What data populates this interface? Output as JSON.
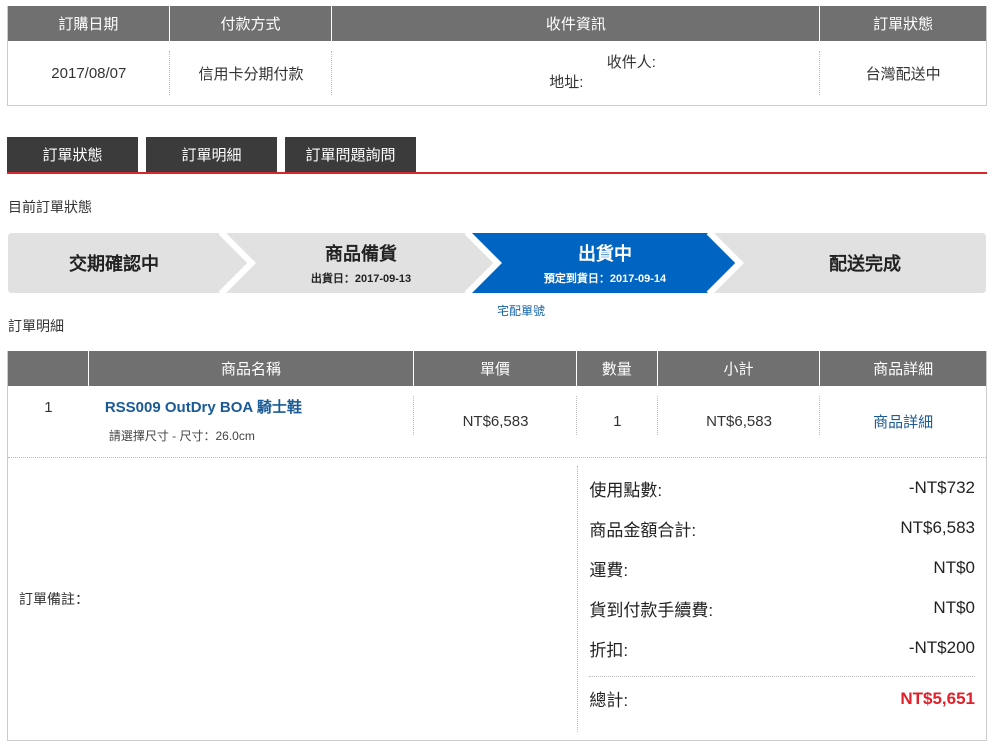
{
  "summary": {
    "headers": [
      "訂購日期",
      "付款方式",
      "收件資訊",
      "訂單狀態"
    ],
    "date": "2017/08/07",
    "payment": "信用卡分期付款",
    "recipient_label": "收件人:",
    "address_label": "地址:",
    "status": "台灣配送中"
  },
  "tabs": [
    "訂單狀態",
    "訂單明細",
    "訂單問題詢問"
  ],
  "status_section_label": "目前訂單狀態",
  "steps": [
    {
      "title": "交期確認中",
      "sub": ""
    },
    {
      "title": "商品備貨",
      "sub": "出貨日：2017-09-13"
    },
    {
      "title": "出貨中",
      "sub": "預定到貨日：2017-09-14"
    },
    {
      "title": "配送完成",
      "sub": ""
    }
  ],
  "active_step": 2,
  "colors": {
    "step_active": "#0064c2",
    "step_inactive": "#e1e1e1",
    "accent_red": "#d9262c"
  },
  "tracking_link": "宅配單號",
  "detail_section_label": "訂單明細",
  "items": {
    "headers": [
      "",
      "商品名稱",
      "單價",
      "數量",
      "小計",
      "商品詳細"
    ],
    "rows": [
      {
        "index": "1",
        "name": "RSS009 OutDry BOA 騎士鞋",
        "spec": "請選擇尺寸 - 尺寸：26.0cm",
        "price": "NT$6,583",
        "qty": "1",
        "subtotal": "NT$6,583",
        "detail": "商品詳細"
      }
    ]
  },
  "note_label": "訂單備註：",
  "totals": {
    "points_label": "使用點數:",
    "points": "-NT$732",
    "goods_label": "商品金額合計:",
    "goods": "NT$6,583",
    "shipping_label": "運費:",
    "shipping": "NT$0",
    "cod_label": "貨到付款手續費:",
    "cod": "NT$0",
    "discount_label": "折扣:",
    "discount": "-NT$200",
    "total_label": "總計:",
    "total": "NT$5,651"
  }
}
